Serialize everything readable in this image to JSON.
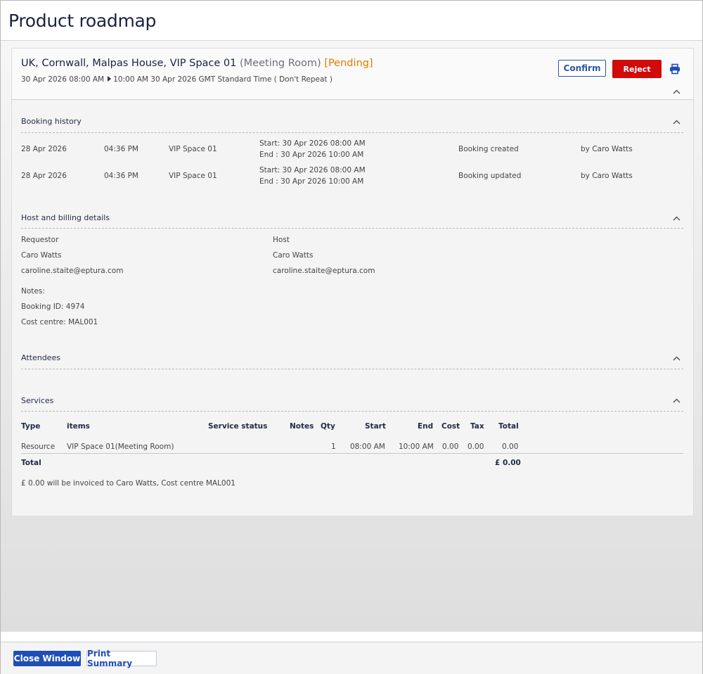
{
  "window": {
    "title": "Product roadmap"
  },
  "booking": {
    "location": "UK, Cornwall, Malpas House, VIP Space 01",
    "type": "(Meeting Room)",
    "status": "[Pending]",
    "start": "30 Apr 2026 08:00 AM",
    "end": "10:00 AM 30 Apr 2026 GMT Standard Time ( Don't Repeat )",
    "confirm_label": "Confirm",
    "reject_label": "Reject"
  },
  "history": {
    "title": "Booking history",
    "rows": [
      {
        "date": "28 Apr 2026",
        "time": "04:36 PM",
        "space": "VIP Space 01",
        "start": "Start: 30 Apr 2026 08:00 AM",
        "end": "End : 30 Apr 2026 10:00 AM",
        "action": "Booking created",
        "by": "by Caro Watts"
      },
      {
        "date": "28 Apr 2026",
        "time": "04:36 PM",
        "space": "VIP Space 01",
        "start": "Start: 30 Apr 2026 08:00 AM",
        "end": "End : 30 Apr 2026 10:00 AM",
        "action": "Booking updated",
        "by": "by Caro Watts"
      }
    ]
  },
  "billing": {
    "title": "Host and billing details",
    "requestor_label": "Requestor",
    "requestor_name": "Caro Watts",
    "requestor_email": "caroline.staite@eptura.com",
    "host_label": "Host",
    "host_name": "Caro Watts",
    "host_email": "caroline.staite@eptura.com",
    "notes": "Notes:",
    "booking_id": "Booking ID: 4974",
    "cost_centre": "Cost centre: MAL001"
  },
  "attendees": {
    "title": "Attendees"
  },
  "services": {
    "title": "Services",
    "headers": {
      "type": "Type",
      "items": "items",
      "status": "Service status",
      "notes": "Notes",
      "qty": "Qty",
      "start": "Start",
      "end": "End",
      "cost": "Cost",
      "tax": "Tax",
      "total": "Total"
    },
    "row": {
      "type": "Resource",
      "items": "VIP Space 01(Meeting Room)",
      "qty": "1",
      "start": "08:00 AM",
      "end": "10:00 AM",
      "cost": "0.00",
      "tax": "0.00",
      "total": "0.00"
    },
    "total_label": "Total",
    "total_value": "£ 0.00",
    "invoice_note": "£ 0.00 will be invoiced to Caro Watts, Cost centre MAL001"
  },
  "footer": {
    "close_label": "Close Window",
    "print_label": "Print Summary"
  },
  "colors": {
    "accent": "#1f4fb5",
    "danger": "#d10a0a",
    "pending": "#e07b00"
  },
  "icons": {
    "print": "printer-icon",
    "collapse": "chevron-up-icon"
  }
}
